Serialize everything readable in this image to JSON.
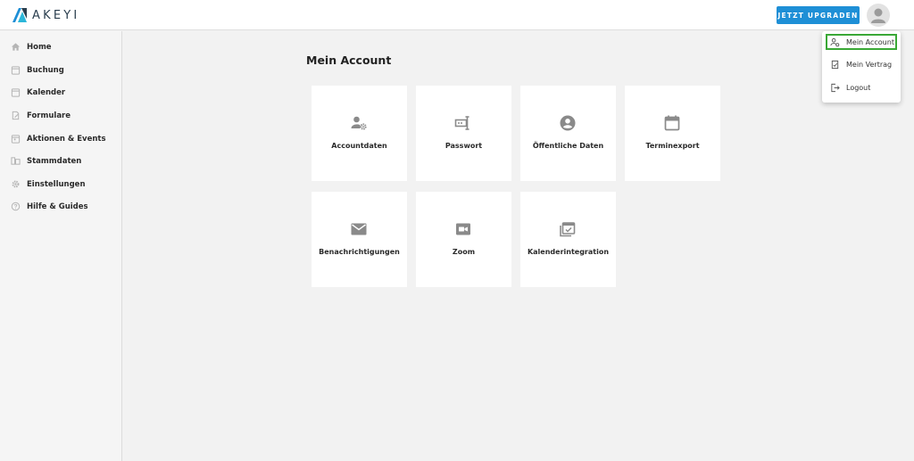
{
  "brand": {
    "name": "AKEYI",
    "accent": "#1e8fd6"
  },
  "header": {
    "upgrade_label": "JETZT UPGRADEN"
  },
  "sidebar": {
    "items": [
      {
        "label": "Home",
        "icon": "home-icon"
      },
      {
        "label": "Buchung",
        "icon": "calendar-icon"
      },
      {
        "label": "Kalender",
        "icon": "calendar-icon"
      },
      {
        "label": "Formulare",
        "icon": "form-icon"
      },
      {
        "label": "Aktionen & Events",
        "icon": "calendar-icon"
      },
      {
        "label": "Stammdaten",
        "icon": "database-icon"
      },
      {
        "label": "Einstellungen",
        "icon": "gear-icon"
      },
      {
        "label": "Hilfe & Guides",
        "icon": "help-icon"
      }
    ]
  },
  "main": {
    "title": "Mein Account",
    "cards": [
      {
        "label": "Accountdaten",
        "icon": "user-settings-icon"
      },
      {
        "label": "Passwort",
        "icon": "password-icon"
      },
      {
        "label": "Öffentliche Daten",
        "icon": "account-circle-icon"
      },
      {
        "label": "Terminexport",
        "icon": "calendar-icon"
      },
      {
        "label": "Benachrichtigungen",
        "icon": "mail-icon"
      },
      {
        "label": "Zoom",
        "icon": "video-camera-icon"
      },
      {
        "label": "Kalenderintegration",
        "icon": "calendar-sync-icon"
      }
    ]
  },
  "dropdown": {
    "items": [
      {
        "label": "Mein Account",
        "icon": "user-settings-icon",
        "active": true
      },
      {
        "label": "Mein Vertrag",
        "icon": "contract-icon",
        "active": false
      },
      {
        "label": "Logout",
        "icon": "logout-icon",
        "active": false
      }
    ]
  }
}
